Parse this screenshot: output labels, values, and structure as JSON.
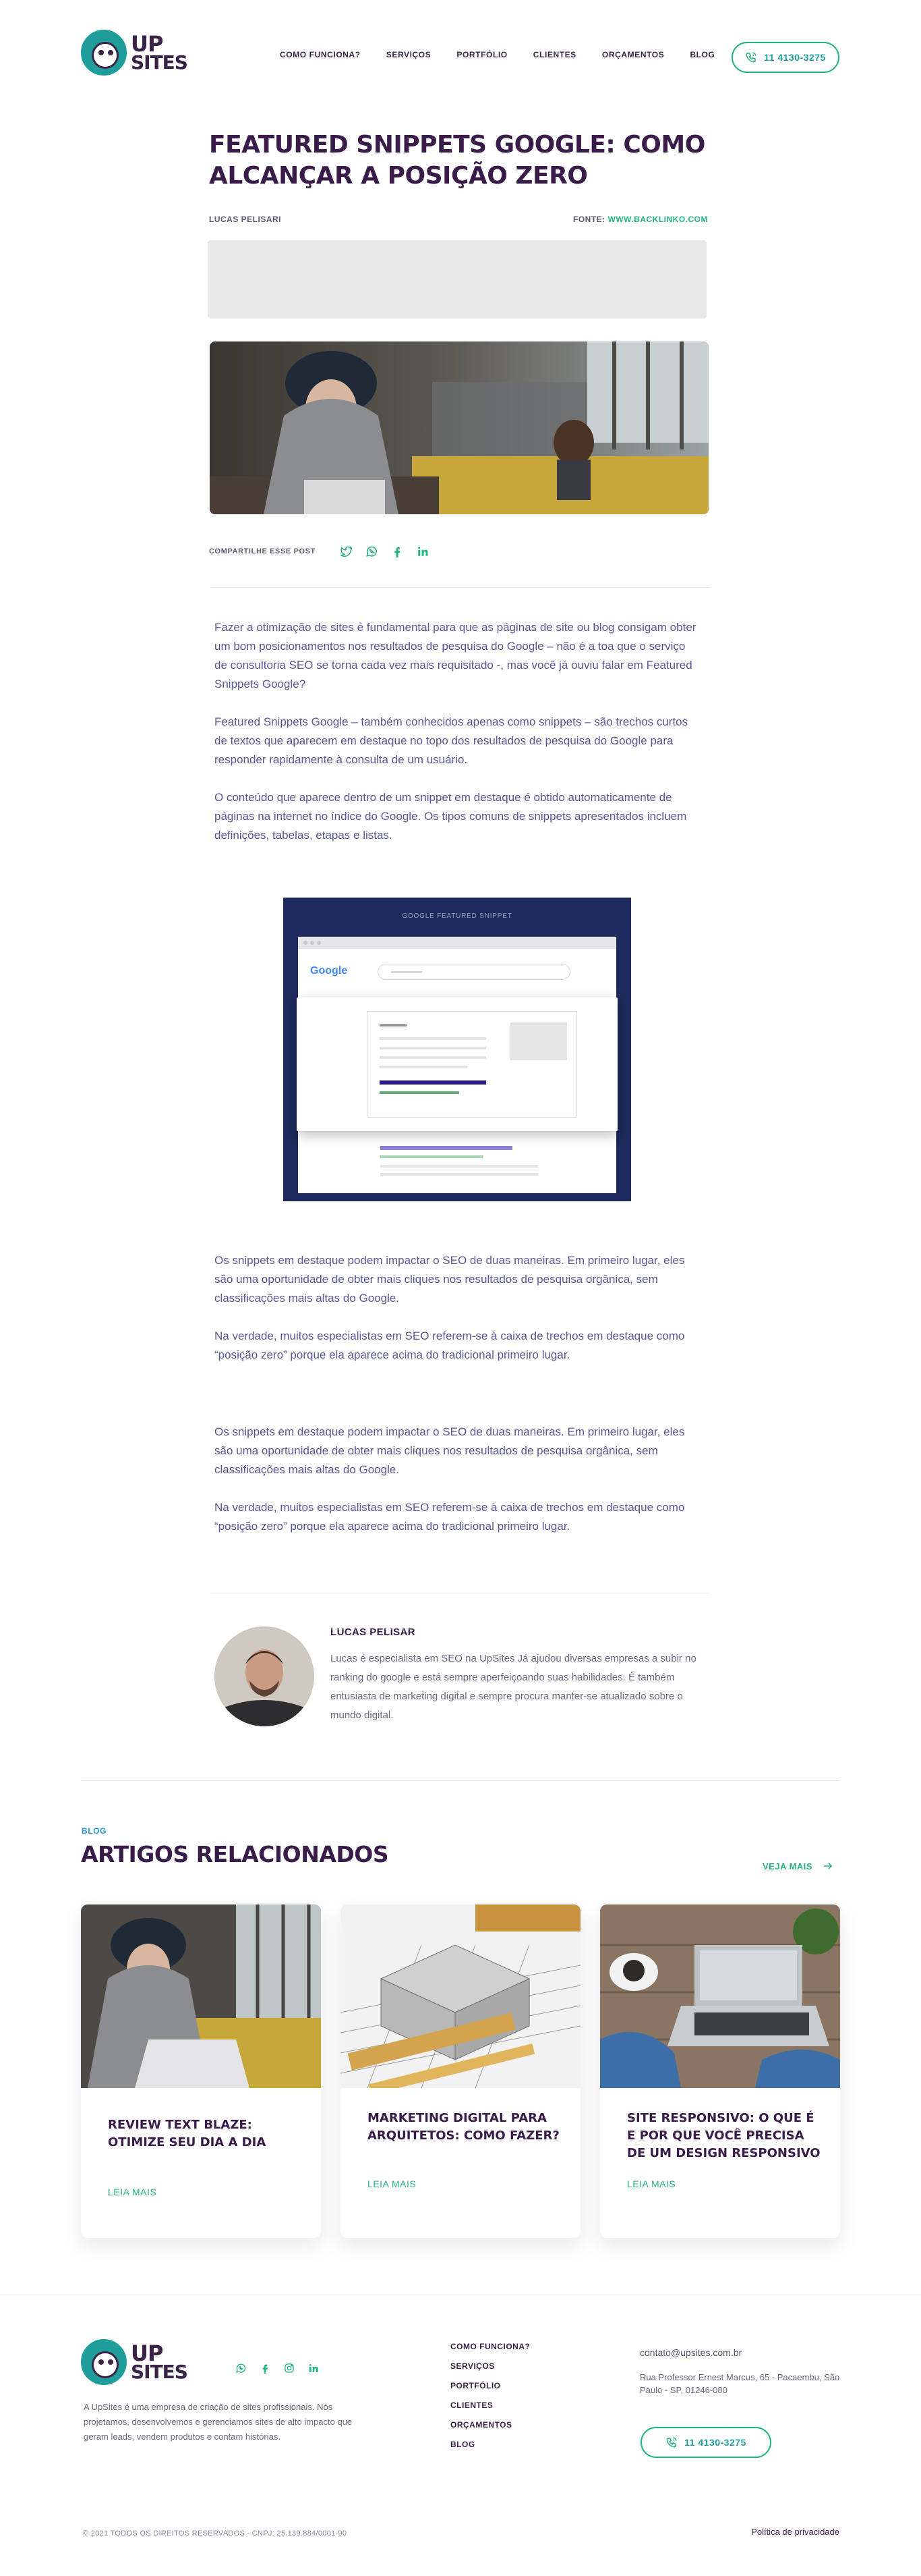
{
  "header": {
    "logo": {
      "line1": "UP",
      "line2": "SITES"
    },
    "nav": [
      "COMO FUNCIONA?",
      "SERVIÇOS",
      "PORTFÓLIO",
      "CLIENTES",
      "ORÇAMENTOS",
      "BLOG"
    ],
    "phone": "11 4130-3275"
  },
  "article": {
    "title": "FEATURED SNIPPETS GOOGLE: COMO ALCANÇAR A POSIÇÃO ZERO",
    "author": "LUCAS PELISARI",
    "source_label": "FONTE:",
    "source_link": "WWW.BACKLINKO.COM",
    "share_label": "COMPARTILHE ESSE POST",
    "share_icons": [
      "twitter-icon",
      "whatsapp-icon",
      "facebook-icon",
      "linkedin-icon"
    ],
    "paragraphs_intro": [
      "Fazer a otimização de sites é fundamental para que as páginas de site ou blog consigam obter um bom posicionamentos nos resultados de pesquisa do Google – não é a toa que o serviço de consultoria SEO se torna cada vez mais requisitado -, mas você já ouviu falar em Featured Snippets Google?",
      "Featured Snippets Google – também conhecidos apenas como snippets – são trechos curtos de textos que aparecem em destaque no topo dos resultados de pesquisa do Google para responder rapidamente à consulta de um usuário.",
      "O conteúdo que aparece dentro de um snippet em destaque é obtido automaticamente de páginas na internet no índice do Google. Os tipos comuns de snippets apresentados incluem definições, tabelas, etapas e listas."
    ],
    "figure": {
      "caption": "GOOGLE FEATURED SNIPPET",
      "logo": "Google"
    },
    "paragraphs_after": [
      "Os snippets em destaque podem impactar o SEO de duas maneiras. Em primeiro lugar, eles são uma oportunidade de obter mais cliques nos resultados de pesquisa orgânica, sem classificações mais altas do Google.",
      "Na verdade, muitos especialistas em SEO referem-se à caixa de trechos em destaque como “posição zero” porque ela aparece acima do tradicional primeiro lugar.",
      "Os snippets em destaque podem impactar o SEO de duas maneiras. Em primeiro lugar, eles são uma oportunidade de obter mais cliques nos resultados de pesquisa orgânica, sem classificações mais altas do Google.",
      "Na verdade, muitos especialistas em SEO referem-se à caixa de trechos em destaque como “posição zero” porque ela aparece acima do tradicional primeiro lugar."
    ],
    "author_box": {
      "name": "LUCAS PELISAR",
      "bio": "Lucas é especialista em SEO na UpSites Já ajudou diversas empresas a subir no ranking do google e está sempre aperfeiçoando suas habilidades. É também entusiasta de marketing digital e sempre procura manter-se atualizado sobre o mundo digital."
    }
  },
  "related": {
    "tag": "BLOG",
    "title": "ARTIGOS RELACIONADOS",
    "see_more": "VEJA MAIS",
    "cards": [
      {
        "title": "REVIEW TEXT BLAZE: OTIMIZE SEU DIA A DIA",
        "link": "LEIA MAIS"
      },
      {
        "title": "MARKETING DIGITAL PARA ARQUITETOS: COMO FAZER?",
        "link": "LEIA MAIS"
      },
      {
        "title": "SITE RESPONSIVO: O QUE É E POR QUE VOCÊ PRECISA DE UM DESIGN RESPONSIVO",
        "link": "LEIA MAIS"
      }
    ]
  },
  "footer": {
    "logo": {
      "line1": "UP",
      "line2": "SITES"
    },
    "social": [
      "whatsapp-icon",
      "facebook-icon",
      "instagram-icon",
      "linkedin-icon"
    ],
    "about": "A UpSites é uma empresa de criação de sites profissionais. Nós projetamos, desenvolvemos e gerenciamos sites de alto impacto que geram leads, vendem produtos e contam histórias.",
    "nav": [
      "COMO FUNCIONA?",
      "SERVIÇOS",
      "PORTFÓLIO",
      "CLIENTES",
      "ORÇAMENTOS",
      "BLOG"
    ],
    "email": "contato@upsites.com.br",
    "address": "Rua Professor Ernest Marcus, 65 - Pacaembu, São Paulo - SP, 01246-080",
    "phone": "11 4130-3275",
    "copyright": "© 2021 TODOS OS DIREITOS RESERVADOS - CNPJ: 25.139.884/0001-90",
    "privacy": "Política de privacidade"
  },
  "colors": {
    "brand": "#3a1c4a",
    "accent": "#24b47e",
    "teal": "#1f9d9b",
    "text": "#5a5796",
    "blue": "#2a9ad1"
  }
}
